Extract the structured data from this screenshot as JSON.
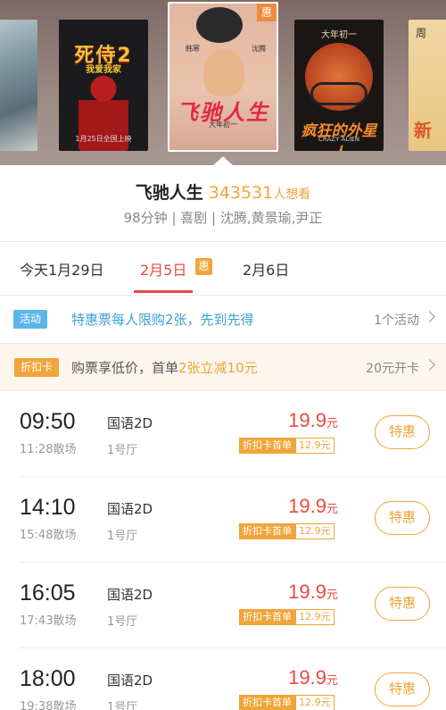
{
  "carousel": {
    "posters": [
      {
        "name": "poster-disaster",
        "title": ""
      },
      {
        "name": "poster-deadpool2",
        "title": "死侍2",
        "subtitle": "我爱我家",
        "date": "1月25日全国上映"
      },
      {
        "name": "poster-feichirensheng",
        "title": "飞驰人生",
        "badge": "惠",
        "left_name": "韩寒",
        "right_name": "沈腾",
        "subtitle": "大年初一"
      },
      {
        "name": "poster-crazy-alien",
        "title": "疯狂的外星人",
        "top_text": "大年初一",
        "subtitle": "CRAZY ALIEN"
      },
      {
        "name": "poster-partial",
        "top_text": "周",
        "title": "新"
      }
    ]
  },
  "movie": {
    "title": "飞驰人生",
    "want_count": "343531",
    "want_label": "人想看",
    "meta": "98分钟 | 喜剧 | 沈腾,黄景瑜,尹正"
  },
  "date_tabs": [
    {
      "label": "今天1月29日"
    },
    {
      "label": "2月5日",
      "badge": "惠",
      "selected": true
    },
    {
      "label": "2月6日"
    }
  ],
  "promos": {
    "activity": {
      "tag": "活动",
      "text": "特惠票每人限购2张，先到先得",
      "right": "1个活动"
    },
    "discount_card": {
      "tag": "折扣卡",
      "text_prefix": "购票享低价，首单",
      "text_highlight": "2张立减10元",
      "right": "20元开卡"
    }
  },
  "showtimes": [
    {
      "start": "09:50",
      "end": "11:28散场",
      "lang": "国语2D",
      "hall": "1号厅",
      "price": "19.9",
      "yuan": "元",
      "card_label": "折扣卡首单",
      "card_price": "12.9元",
      "button": "特惠"
    },
    {
      "start": "14:10",
      "end": "15:48散场",
      "lang": "国语2D",
      "hall": "1号厅",
      "price": "19.9",
      "yuan": "元",
      "card_label": "折扣卡首单",
      "card_price": "12.9元",
      "button": "特惠"
    },
    {
      "start": "16:05",
      "end": "17:43散场",
      "lang": "国语2D",
      "hall": "1号厅",
      "price": "19.9",
      "yuan": "元",
      "card_label": "折扣卡首单",
      "card_price": "12.9元",
      "button": "特惠"
    },
    {
      "start": "18:00",
      "end": "19:38散场",
      "lang": "国语2D",
      "hall": "1号厅",
      "price": "19.9",
      "yuan": "元",
      "card_label": "折扣卡首单",
      "card_price": "12.9元",
      "button": "特惠"
    }
  ],
  "colors": {
    "accent_orange": "#f0a43a",
    "accent_red": "#e94b3c",
    "activity_blue": "#5bb5e8"
  }
}
